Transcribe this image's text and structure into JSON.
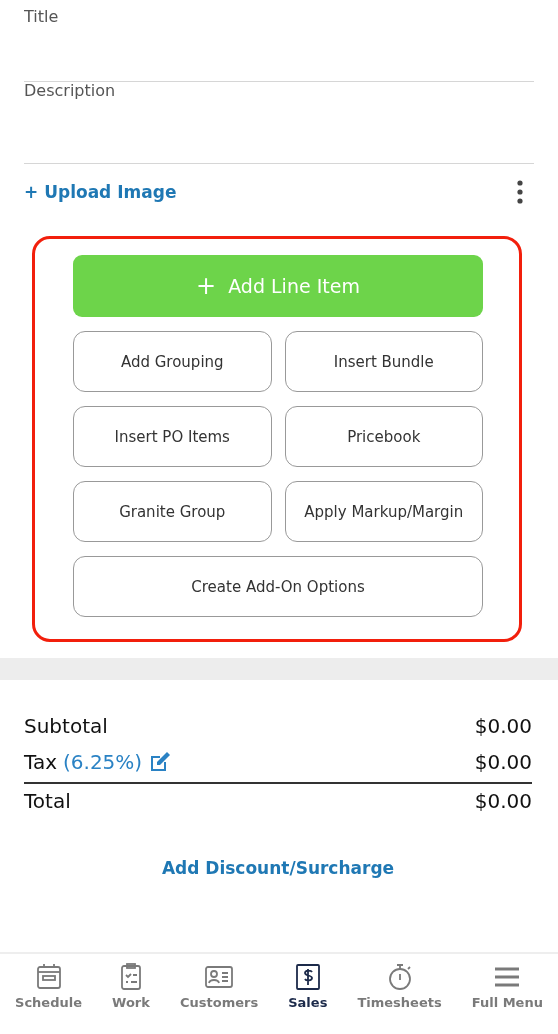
{
  "fields": [
    {
      "placeholder": "Title"
    },
    {
      "placeholder": "Description"
    }
  ],
  "upload_link": "+ Upload Image",
  "primary_button": {
    "icon": "+",
    "label": "Add Line Item"
  },
  "actions": [
    {
      "label": "Add Grouping",
      "wide": false
    },
    {
      "label": "Insert Bundle",
      "wide": false
    },
    {
      "label": "Insert PO Items",
      "wide": false
    },
    {
      "label": "Pricebook",
      "wide": false
    },
    {
      "label": "Granite Group",
      "wide": false
    },
    {
      "label": "Apply Markup/Margin",
      "wide": false
    },
    {
      "label": "Create Add-On Options",
      "wide": true
    }
  ],
  "totals": {
    "subtotal_label": "Subtotal",
    "subtotal": "$0.00",
    "tax_label": "Tax",
    "tax_rate": "(6.25%)",
    "tax": "$0.00",
    "total_label": "Total",
    "total": "$0.00"
  },
  "discount_link": "Add Discount/Surcharge",
  "nav": [
    {
      "label": "Schedule",
      "selected": false
    },
    {
      "label": "Work",
      "selected": false
    },
    {
      "label": "Customers",
      "selected": false
    },
    {
      "label": "Sales",
      "selected": true
    },
    {
      "label": "Timesheets",
      "selected": false
    },
    {
      "label": "Full Menu",
      "selected": false
    }
  ]
}
